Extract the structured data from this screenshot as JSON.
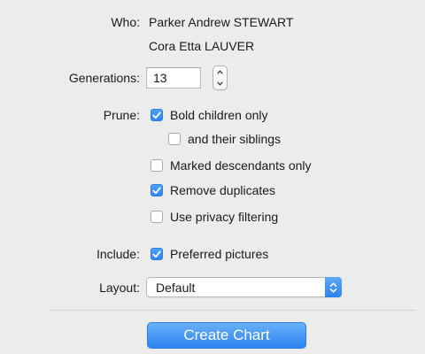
{
  "who": {
    "label": "Who:",
    "person1": "Parker Andrew STEWART",
    "person2": "Cora Etta LAUVER"
  },
  "generations": {
    "label": "Generations:",
    "value": "13"
  },
  "prune": {
    "label": "Prune:",
    "options": [
      {
        "label": "Bold children only",
        "checked": true
      },
      {
        "label": "and their siblings",
        "checked": false
      },
      {
        "label": "Marked descendants only",
        "checked": false
      },
      {
        "label": "Remove duplicates",
        "checked": true
      },
      {
        "label": "Use privacy filtering",
        "checked": false
      }
    ]
  },
  "include": {
    "label": "Include:",
    "options": [
      {
        "label": "Preferred pictures",
        "checked": true
      }
    ]
  },
  "layout": {
    "label": "Layout:",
    "selected": "Default"
  },
  "create_button": "Create Chart",
  "colors": {
    "accent": "#2f84f0",
    "background": "#ececec"
  }
}
